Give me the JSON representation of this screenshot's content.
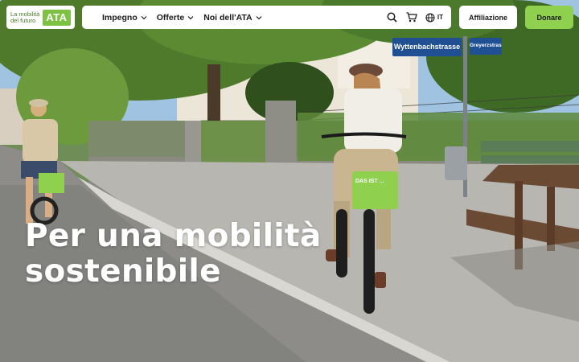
{
  "logo": {
    "line1": "La mobilità",
    "line2": "del futuro",
    "mark": "ATA"
  },
  "nav": {
    "items": [
      {
        "label": "Impegno",
        "icon": "chevron-down-icon"
      },
      {
        "label": "Offerte",
        "icon": "chevron-down-icon"
      },
      {
        "label": "Noi dell'ATA",
        "icon": "chevron-down-icon"
      }
    ],
    "search_icon": "search-icon",
    "cart_icon": "cart-icon",
    "language_icon": "globe-icon",
    "language": "IT"
  },
  "actions": {
    "membership_label": "Affiliazione",
    "donate_label": "Donare"
  },
  "hero": {
    "title_line1": "Per una mobilità",
    "title_line2": "sostenibile",
    "street_sign_1": "Wyttenbachstrasse",
    "street_sign_2": "Greyerzstrasse",
    "bike_basket_text": "DAS IST ..."
  },
  "colors": {
    "accent_green": "#8fd14f",
    "brand_green": "#7dc242",
    "text_dark": "#1b1b1b",
    "white": "#ffffff"
  }
}
